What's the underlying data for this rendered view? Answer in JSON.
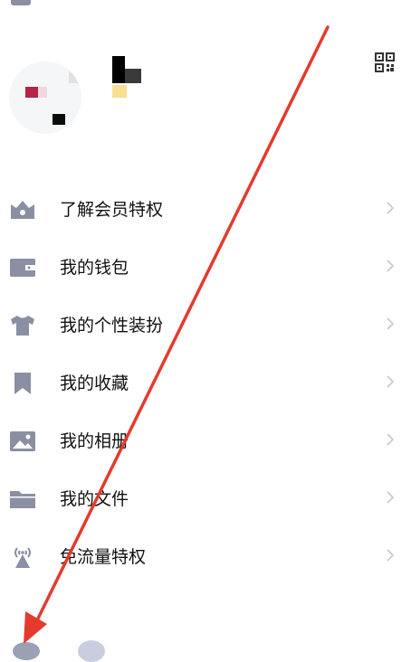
{
  "header": {
    "title": "",
    "left_icon": "menu-icon",
    "right_icon": "close-icon"
  },
  "profile": {
    "qr_icon": "qr-code-icon"
  },
  "menu": {
    "items": [
      {
        "label": "了解会员特权",
        "icon": "vip-badge-icon"
      },
      {
        "label": "我的钱包",
        "icon": "wallet-icon"
      },
      {
        "label": "我的个性装扮",
        "icon": "tshirt-icon"
      },
      {
        "label": "我的收藏",
        "icon": "bookmark-icon"
      },
      {
        "label": "我的相册",
        "icon": "photo-icon"
      },
      {
        "label": "我的文件",
        "icon": "folder-icon"
      },
      {
        "label": "免流量特权",
        "icon": "signal-tower-icon"
      }
    ]
  },
  "colors": {
    "icon": "#8a8fa3",
    "chevron": "#c7c7cc",
    "annotation_arrow": "#e53a2e"
  }
}
